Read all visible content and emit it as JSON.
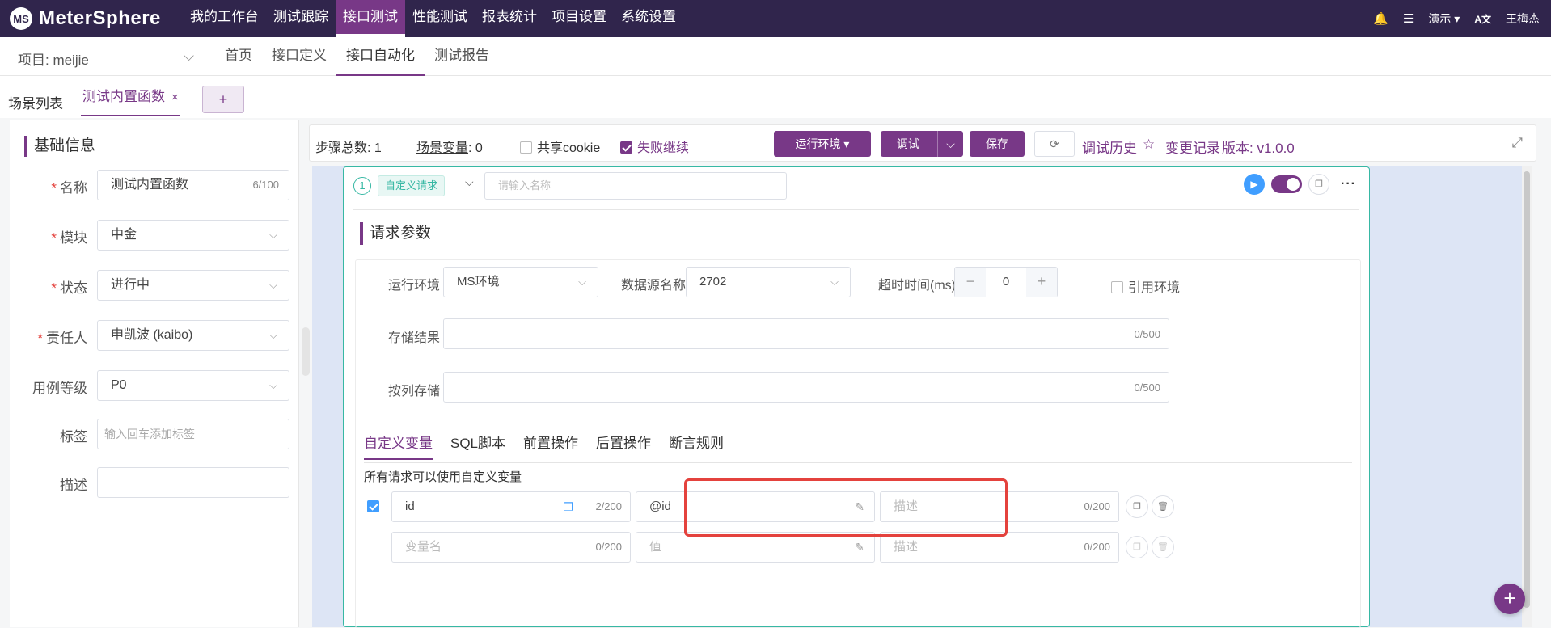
{
  "app": {
    "logo": "MS",
    "name": "MeterSphere"
  },
  "topnav": [
    "我的工作台",
    "测试跟踪",
    "接口测试",
    "性能测试",
    "报表统计",
    "项目设置",
    "系统设置"
  ],
  "topright": {
    "workspace": "演示",
    "lang": "A文",
    "user": "王梅杰"
  },
  "project": {
    "label": "项目: meijie"
  },
  "subnav": [
    "首页",
    "接口定义",
    "接口自动化",
    "测试报告"
  ],
  "tabs": {
    "list_label": "场景列表",
    "active_label": "测试内置函数",
    "close": "×",
    "add": "+"
  },
  "basic_info": {
    "title": "基础信息",
    "fields": [
      {
        "label": "名称",
        "required": true,
        "value": "测试内置函数",
        "count": "6/100"
      },
      {
        "label": "模块",
        "required": true,
        "value": "中金"
      },
      {
        "label": "状态",
        "required": true,
        "value": "进行中"
      },
      {
        "label": "责任人",
        "required": true,
        "value": "申凯波 (kaibo)"
      },
      {
        "label": "用例等级",
        "required": false,
        "value": "P0"
      },
      {
        "label": "标签",
        "required": false,
        "placeholder": "输入回车添加标签"
      },
      {
        "label": "描述",
        "required": false,
        "value": ""
      }
    ]
  },
  "toolbar": {
    "steps_total_label": "步骤总数:",
    "steps_total": "1",
    "scene_var_label": "场景变量",
    "scene_var_count": ": 0",
    "share_cookie": "共享cookie",
    "fail_continue": "失败继续",
    "run_env": "运行环境",
    "debug": "调试",
    "save": "保存",
    "debug_history": "调试历史",
    "change_log": "变更记录",
    "version": "版本: v1.0.0"
  },
  "step": {
    "index": "1",
    "type": "自定义请求",
    "name_placeholder": "请输入名称"
  },
  "request": {
    "title": "请求参数",
    "env_label": "运行环境",
    "env_value": "MS环境",
    "ds_label": "数据源名称",
    "ds_value": "2702",
    "timeout_label": "超时时间(ms)",
    "timeout_value": "0",
    "ref_env": "引用环境",
    "store_result_label": "存储结果",
    "store_result_count": "0/500",
    "store_col_label": "按列存储",
    "store_col_count": "0/500",
    "subtabs": [
      "自定义变量",
      "SQL脚本",
      "前置操作",
      "后置操作",
      "断言规则"
    ],
    "hint": "所有请求可以使用自定义变量",
    "variables": [
      {
        "name": "id",
        "name_count": "2/200",
        "value": "@id",
        "desc_placeholder": "描述",
        "desc_count": "0/200"
      },
      {
        "name_placeholder": "变量名",
        "name_count": "0/200",
        "value_placeholder": "值",
        "desc_placeholder": "描述",
        "desc_count": "0/200"
      }
    ]
  },
  "colors": {
    "topbar": "#30254c",
    "accent": "#783887",
    "teal": "#37b8a4",
    "highlight": "#e4423d"
  },
  "icons": [
    "bell-icon",
    "tasks-icon",
    "chevron-down-icon",
    "translate-icon",
    "refresh-icon",
    "star-icon",
    "expand-icon",
    "play-icon",
    "copy-icon",
    "more-icon",
    "edit-icon",
    "delete-icon",
    "plus-icon"
  ]
}
